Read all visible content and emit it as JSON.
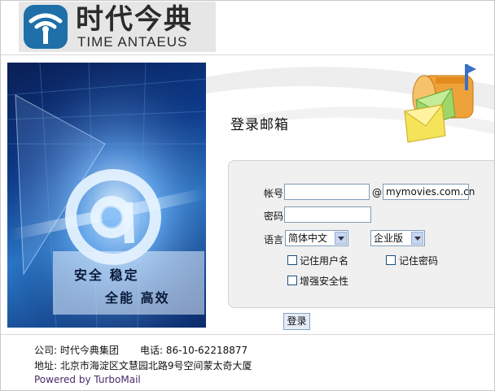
{
  "brand": {
    "name_cn": "时代今典",
    "name_en": "TIME ANTAEUS"
  },
  "hero": {
    "slogan_line1": "安全  稳定",
    "slogan_line2": "全能  高效"
  },
  "login": {
    "title": "登录邮箱",
    "account_label": "帐号",
    "account_value": "",
    "at_sign": "@",
    "domain_value": "mymovies.com.cn",
    "password_label": "密码",
    "language_label": "语言",
    "language_selected": "简体中文",
    "edition_selected": "企业版",
    "remember_user": "记住用户名",
    "remember_password": "记住密码",
    "enhanced_security": "增强安全性",
    "submit_label": "登录"
  },
  "footer": {
    "company": "公司: 时代今典集团",
    "phone": "电话: 86-10-62218877",
    "address": "地址: 北京市海淀区文慧园北路9号空间蒙太奇大厦",
    "powered_by": "Powered by TurboMail"
  },
  "colors": {
    "brand_blue": "#1f6fa8",
    "input_border": "#7f9db9",
    "panel_bg": "#f0f0f0",
    "powered_text": "#4a2a6a"
  }
}
